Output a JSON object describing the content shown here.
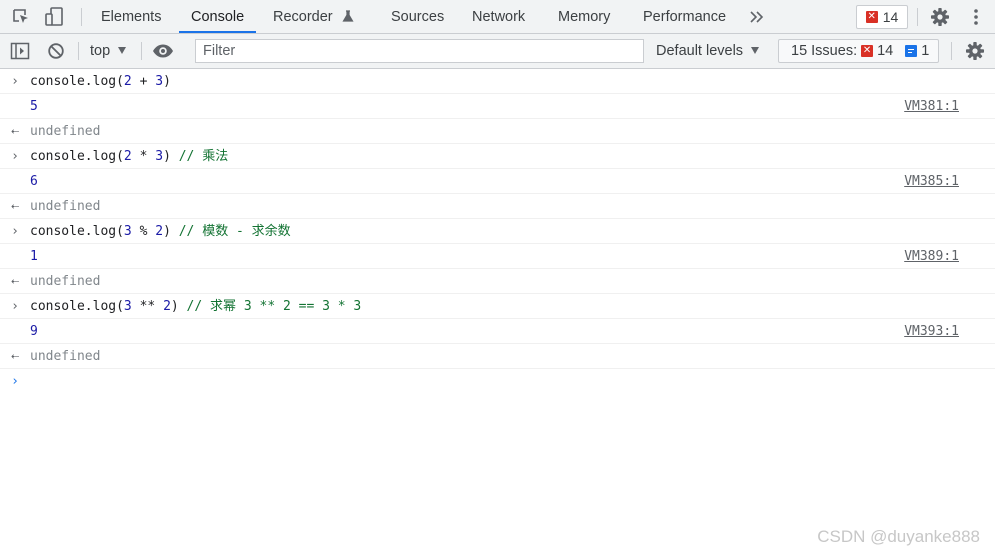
{
  "tabs": [
    {
      "label": "Elements"
    },
    {
      "label": "Console"
    },
    {
      "label": "Recorder"
    },
    {
      "label": "Sources"
    },
    {
      "label": "Network"
    },
    {
      "label": "Memory"
    },
    {
      "label": "Performance"
    }
  ],
  "error_badge_count": "14",
  "toolbar": {
    "context": "top",
    "filter_placeholder": "Filter",
    "levels": "Default levels",
    "issues_label": "15 Issues:",
    "issues_errors": "14",
    "issues_info": "1"
  },
  "console": {
    "entries": [
      {
        "code": "console.log",
        "p1": "(",
        "a": "2",
        "op": " + ",
        "b": "3",
        "p2": ")",
        "comment": "",
        "output": "5",
        "source": "VM381:1",
        "return": "undefined"
      },
      {
        "code": "console.log",
        "p1": "(",
        "a": "2",
        "op": " * ",
        "b": "3",
        "p2": ")",
        "comment": " // 乘法",
        "output": "6",
        "source": "VM385:1",
        "return": "undefined"
      },
      {
        "code": "console.log",
        "p1": "(",
        "a": "3",
        "op": " % ",
        "b": "2",
        "p2": ")",
        "comment": " // 模数 - 求余数",
        "output": "1",
        "source": "VM389:1",
        "return": "undefined"
      },
      {
        "code": "console.log",
        "p1": "(",
        "a": "3",
        "op": " ** ",
        "b": "2",
        "p2": ")",
        "comment": " // 求幂 3 ** 2 == 3 * 3",
        "output": "9",
        "source": "VM393:1",
        "return": "undefined"
      }
    ]
  },
  "watermark": "CSDN @duyanke888",
  "colors": {
    "accent": "#1a73e8",
    "error": "#d93025",
    "number": "#1a1aa6",
    "comment": "#137333"
  }
}
